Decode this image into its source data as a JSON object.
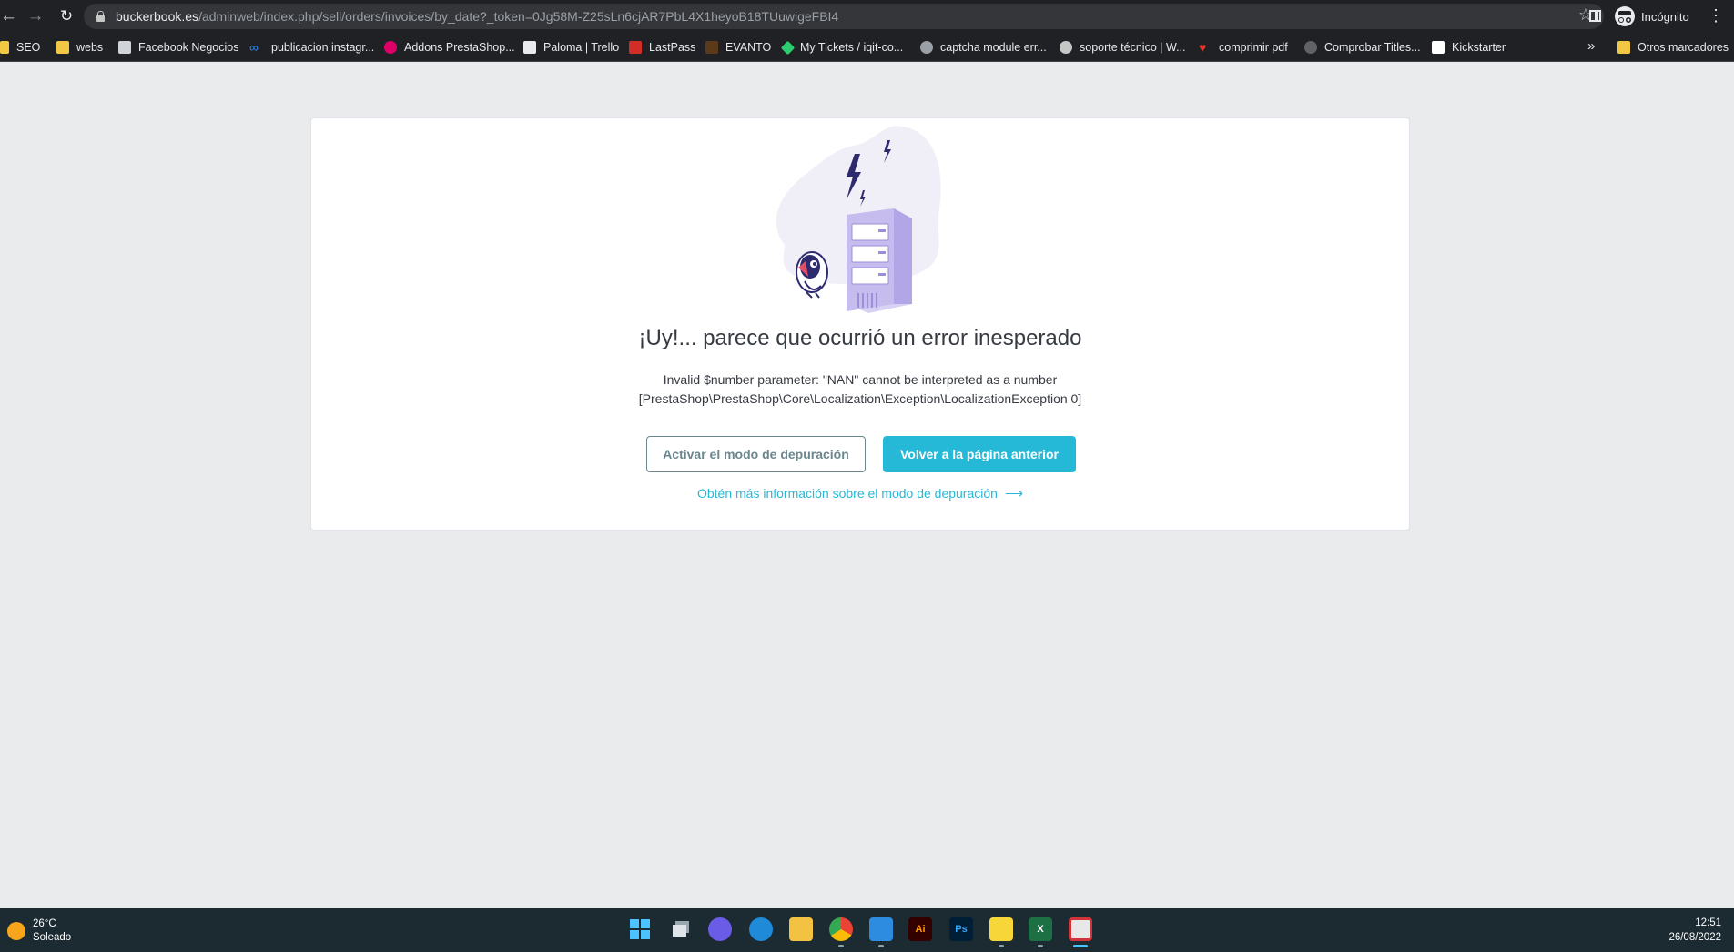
{
  "browser": {
    "url_host": "buckerbook.es",
    "url_path": "/adminweb/index.php/sell/orders/invoices/by_date?_token=0Jg58M-Z25sLn6cjAR7PbL4X1heyoB18TUuwigeFBI4",
    "incognito_label": "Incógnito",
    "bookmarks": [
      {
        "label": "SEO",
        "icon": "folder-icon"
      },
      {
        "label": "webs",
        "icon": "folder-icon"
      },
      {
        "label": "Facebook Negocios",
        "icon": "facebook-business-icon"
      },
      {
        "label": "publicacion instagr...",
        "icon": "meta-icon"
      },
      {
        "label": "Addons PrestaShop...",
        "icon": "prestashop-icon"
      },
      {
        "label": "Paloma | Trello",
        "icon": "trello-icon"
      },
      {
        "label": "LastPass",
        "icon": "lastpass-icon"
      },
      {
        "label": "EVANTO",
        "icon": "evanto-icon"
      },
      {
        "label": "My Tickets / iqit-co...",
        "icon": "ticket-icon"
      },
      {
        "label": "captcha module err...",
        "icon": "captcha-icon"
      },
      {
        "label": "soporte técnico | W...",
        "icon": "wordpress-icon"
      },
      {
        "label": "comprimir pdf",
        "icon": "heart-icon"
      },
      {
        "label": "Comprobar Titles...",
        "icon": "globe-icon"
      },
      {
        "label": "Kickstarter",
        "icon": "kickstarter-icon"
      }
    ],
    "more_bookmarks": "»",
    "other_bookmarks": "Otros marcadores",
    "colors": {
      "chrome_bg": "#202124",
      "omnibox_bg": "#35363a"
    }
  },
  "error_page": {
    "title": "¡Uy!... parece que ocurrió un error inesperado",
    "message_line1": "Invalid $number parameter: \"NAN\" cannot be interpreted as a number",
    "message_line2": "[PrestaShop\\PrestaShop\\Core\\Localization\\Exception\\LocalizationException 0]",
    "debug_button": "Activar el modo de depuración",
    "back_button": "Volver a la página anterior",
    "more_info_link": "Obtén más información sobre el modo de depuración",
    "illustration": "server-with-lightning-and-puffin",
    "colors": {
      "primary": "#25b9d7",
      "outline": "#6c868e",
      "text": "#363a41",
      "page_bg": "#eaebed"
    }
  },
  "taskbar": {
    "temperature": "26°C",
    "weather": "Soleado",
    "time": "12:51",
    "date": "26/08/2022",
    "apps": [
      "windows-start-icon",
      "task-view-icon",
      "teams-chat-icon",
      "edge-icon",
      "file-explorer-icon",
      "chrome-icon",
      "outlook-icon",
      "illustrator-icon",
      "photoshop-icon",
      "sticky-notes-icon",
      "excel-icon",
      "snipping-tool-icon"
    ]
  }
}
